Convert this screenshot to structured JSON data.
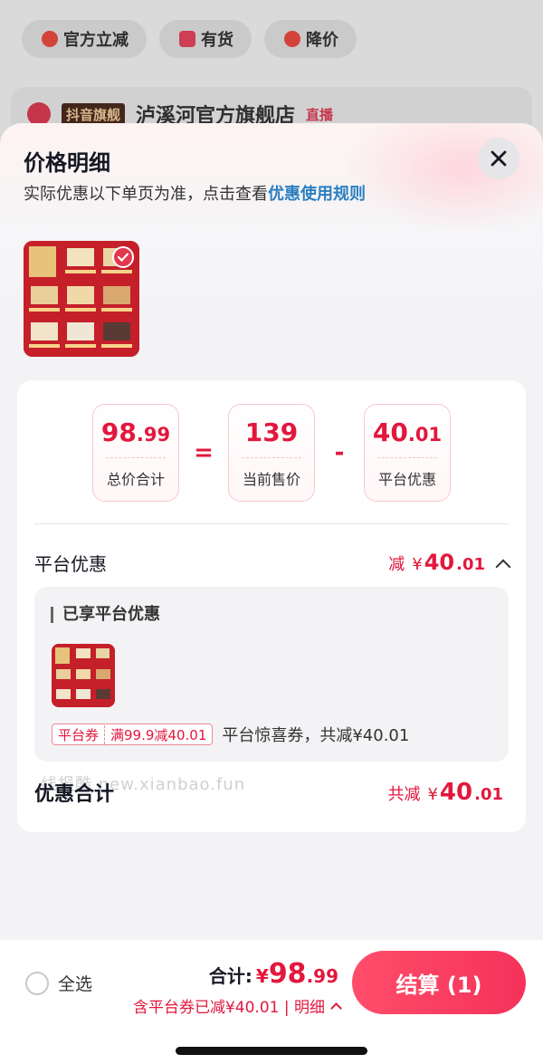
{
  "background": {
    "chips": [
      {
        "label": "官方立减",
        "icon": "red-circle-icon"
      },
      {
        "label": "有货",
        "icon": "red-square-icon"
      },
      {
        "label": "降价",
        "icon": "down-arrow-circle-icon"
      }
    ],
    "store_tag": "抖音旗舰",
    "store_name": "泸溪河官方旗舰店",
    "store_live": "直播"
  },
  "sheet": {
    "title": "价格明细",
    "subtitle_prefix": "实际优惠以下单页为准，点击查看",
    "subtitle_link": "优惠使用规则"
  },
  "calc": {
    "total": {
      "int": "98",
      "dec": ".99",
      "label": "总价合计"
    },
    "op1": "=",
    "price": {
      "int": "139",
      "dec": "",
      "label": "当前售价"
    },
    "op2": "-",
    "discount": {
      "int": "40",
      "dec": ".01",
      "label": "平台优惠"
    }
  },
  "platform": {
    "title": "平台优惠",
    "prefix": "减",
    "currency": "¥",
    "int": "40",
    "dec": ".01",
    "section_title": "已享平台优惠",
    "coupon_type": "平台券",
    "coupon_rule": "满99.9减40.01",
    "coupon_desc": "平台惊喜券，共减¥40.01"
  },
  "summary": {
    "title": "优惠合计",
    "prefix": "共减",
    "currency": "¥",
    "int": "40",
    "dec": ".01"
  },
  "watermark": "线报酷 new.xianbao.fun",
  "bottom_bar": {
    "select_all": "全选",
    "total_label": "合计:",
    "currency": "¥",
    "int": "98",
    "dec": ".99",
    "sub": "含平台券已减¥40.01 | 明细",
    "pay_button": "结算 (1)"
  },
  "colors": {
    "accent": "#e3173d",
    "link": "#2a7fc1",
    "button": "#f5325a"
  }
}
